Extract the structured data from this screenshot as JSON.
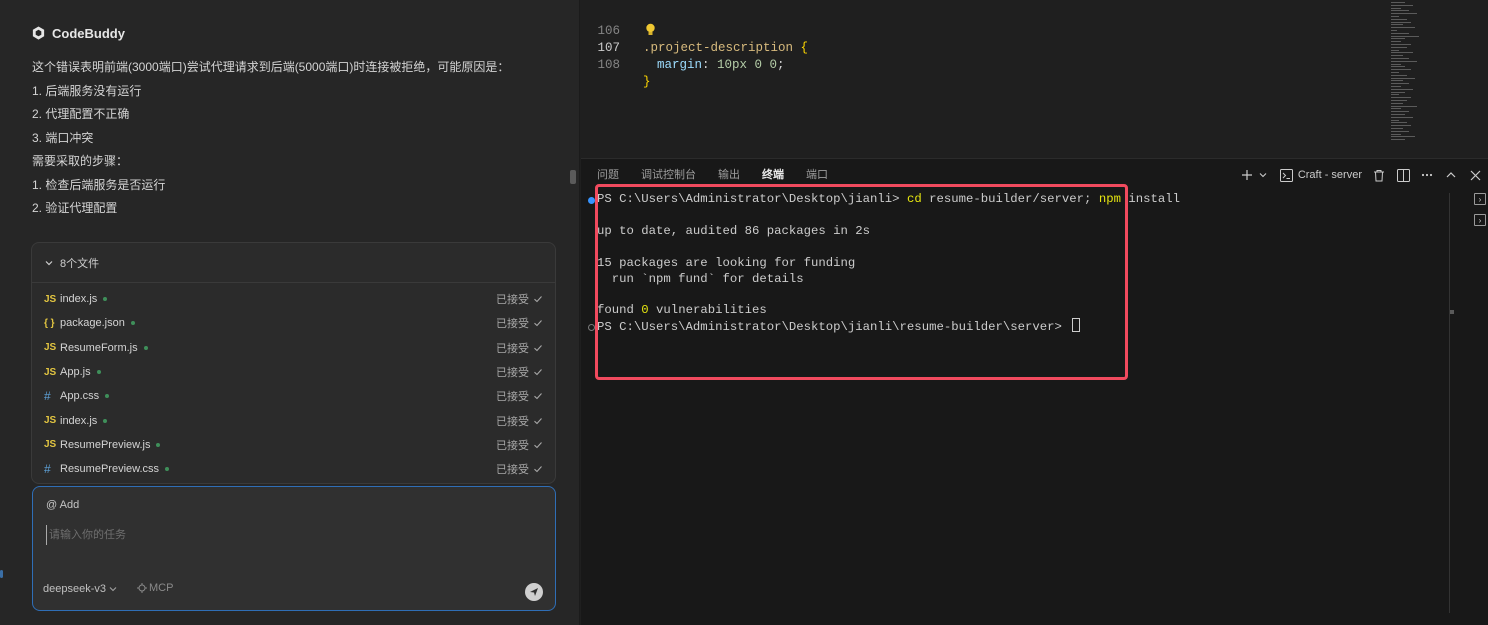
{
  "chat": {
    "brand": "CodeBuddy",
    "message_lines": [
      "这个错误表明前端(3000端口)尝试代理请求到后端(5000端口)时连接被拒绝，可能原因是：",
      "1. 后端服务没有运行",
      "2. 代理配置不正确",
      "3. 端口冲突",
      "需要采取的步骤：",
      "1. 检查后端服务是否运行",
      "2. 验证代理配置"
    ],
    "files_header": "8个文件",
    "files": [
      {
        "icon": "JS",
        "type": "js",
        "name": "index.js",
        "status": "已接受"
      },
      {
        "icon": "{ }",
        "type": "json",
        "name": "package.json",
        "status": "已接受"
      },
      {
        "icon": "JS",
        "type": "js",
        "name": "ResumeForm.js",
        "status": "已接受"
      },
      {
        "icon": "JS",
        "type": "js",
        "name": "App.js",
        "status": "已接受"
      },
      {
        "icon": "#",
        "type": "css",
        "name": "App.css",
        "status": "已接受"
      },
      {
        "icon": "JS",
        "type": "js",
        "name": "index.js",
        "status": "已接受"
      },
      {
        "icon": "JS",
        "type": "js",
        "name": "ResumePreview.js",
        "status": "已接受"
      },
      {
        "icon": "#",
        "type": "css",
        "name": "ResumePreview.css",
        "status": "已接受"
      }
    ],
    "composer": {
      "add_label": "@ Add",
      "placeholder": "请输入你的任务",
      "model": "deepseek-v3",
      "mcp": "MCP"
    }
  },
  "editor": {
    "lines": [
      {
        "num": "106",
        "selector": ".project-description",
        "brace": " {"
      },
      {
        "num": "107",
        "prop": "margin",
        "value": "10px 0 0"
      },
      {
        "num": "108",
        "brace": "}"
      }
    ]
  },
  "panel": {
    "tabs": [
      "问题",
      "调试控制台",
      "输出",
      "终端",
      "端口"
    ],
    "active_tab": "终端",
    "terminal_name": "Craft - server",
    "terminal": {
      "prompt1": "PS C:\\Users\\Administrator\\Desktop\\jianli> ",
      "cmd_cd": "cd",
      "cmd_cd_arg": " resume-builder/server; ",
      "cmd_npm": "npm",
      "cmd_npm_arg": " install",
      "line2": "up to date, audited 86 packages in 2s",
      "line3": "15 packages are looking for funding",
      "line4": "  run `npm fund` for details",
      "line5_a": "found ",
      "line5_b": "0",
      "line5_c": " vulnerabilities",
      "prompt2": "PS C:\\Users\\Administrator\\Desktop\\jianli\\resume-builder\\server> "
    }
  },
  "colors": {
    "accent": "#2f6eb6",
    "highlight_box": "#f04a5e",
    "js_icon": "#e2c541",
    "css_icon": "#5ea2d8"
  }
}
